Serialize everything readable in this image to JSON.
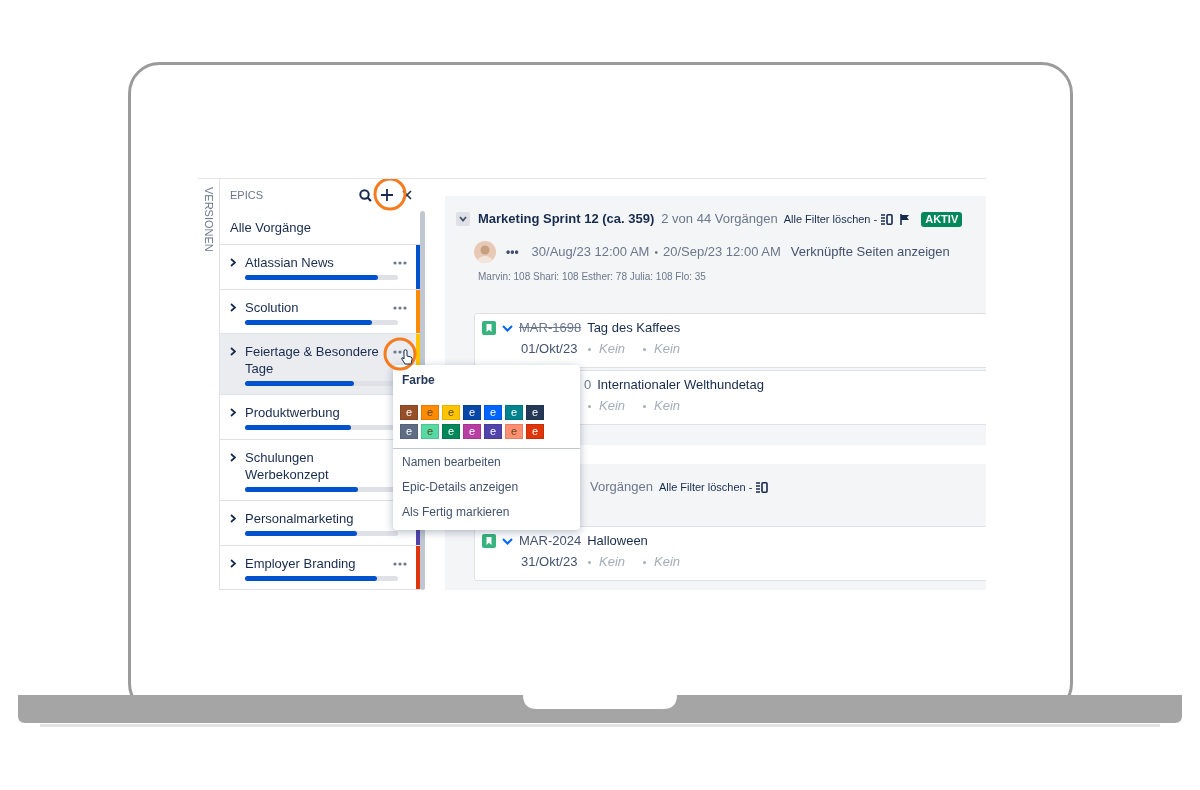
{
  "sidebar_tab": {
    "label": "VERSIONEN"
  },
  "epics": {
    "title": "EPICS",
    "all_label": "Alle Vorgänge",
    "items": [
      {
        "name": "Atlassian News",
        "level": 0.87,
        "color": "#0052cc",
        "menu_button": true,
        "selected": false
      },
      {
        "name": "Scolution",
        "level": 0.83,
        "color": "#ff8b00",
        "menu_button": true,
        "selected": false
      },
      {
        "name": "Feiertage & Besondere Tage",
        "level": 0.71,
        "color": "#ffc400",
        "menu_button": true,
        "selected": true
      },
      {
        "name": "Produktwerbung",
        "level": 0.69,
        "menu_button": false,
        "selected": false
      },
      {
        "name": "Schulungen Werbekonzept",
        "level": 0.74,
        "menu_button": false,
        "selected": false
      },
      {
        "name": "Personalmarketing",
        "level": 0.73,
        "color": "#5243aa",
        "menu_button": false,
        "selected": false
      },
      {
        "name": "Employer Branding",
        "level": 0.86,
        "color": "#de350b",
        "menu_button": true,
        "selected": false
      }
    ]
  },
  "context_menu": {
    "title": "Farbe",
    "swatches": [
      {
        "label": "e",
        "color": "#974f27"
      },
      {
        "label": "e",
        "color": "#ff8b00"
      },
      {
        "label": "e",
        "color": "#ffc400"
      },
      {
        "label": "e",
        "color": "#0747a6"
      },
      {
        "label": "e",
        "color": "#0065ff"
      },
      {
        "label": "e",
        "color": "#00838f"
      },
      {
        "label": "e",
        "color": "#253858"
      },
      {
        "label": "e",
        "color": "#5e6c84"
      },
      {
        "label": "e",
        "color": "#57d9a3"
      },
      {
        "label": "e",
        "color": "#00875a"
      },
      {
        "label": "e",
        "color": "#b83ea3"
      },
      {
        "label": "e",
        "color": "#5243aa"
      },
      {
        "label": "e",
        "color": "#ff8f73"
      },
      {
        "label": "e",
        "color": "#de350b"
      }
    ],
    "items": [
      "Namen bearbeiten",
      "Epic-Details anzeigen",
      "Als Fertig markieren"
    ]
  },
  "sprints": [
    {
      "title": "Marketing Sprint 12 (ca. 359)",
      "count": "2 von 44 Vorgängen",
      "clear_filters": "Alle Filter löschen -",
      "flag": true,
      "status": "AKTIV",
      "more": "•••",
      "start": "30/Aug/23 12:00 AM",
      "separator": "•",
      "end": "20/Sep/23 12:00 AM",
      "linked_pages": "Verknüpfte Seiten anzeigen",
      "workload": "Marvin: 108 Shari: 108 Esther: 78 Julia: 108 Flo: 35",
      "issues": [
        {
          "key": "MAR-1698",
          "done": true,
          "title": "Tag des Kaffees",
          "date": "01/Okt/23",
          "fields": [
            "Kein",
            "Kein"
          ]
        },
        {
          "key_tail": "0",
          "title": "Internationaler Welthundetag",
          "fields": [
            "Kein",
            "Kein"
          ]
        }
      ]
    },
    {
      "count": "Vorgängen",
      "clear_filters": "Alle Filter löschen -",
      "flag": false,
      "issues": [
        {
          "key": "MAR-2024",
          "done": false,
          "title": "Halloween",
          "date": "31/Okt/23",
          "fields": [
            "Kein",
            "Kein"
          ]
        }
      ]
    }
  ]
}
